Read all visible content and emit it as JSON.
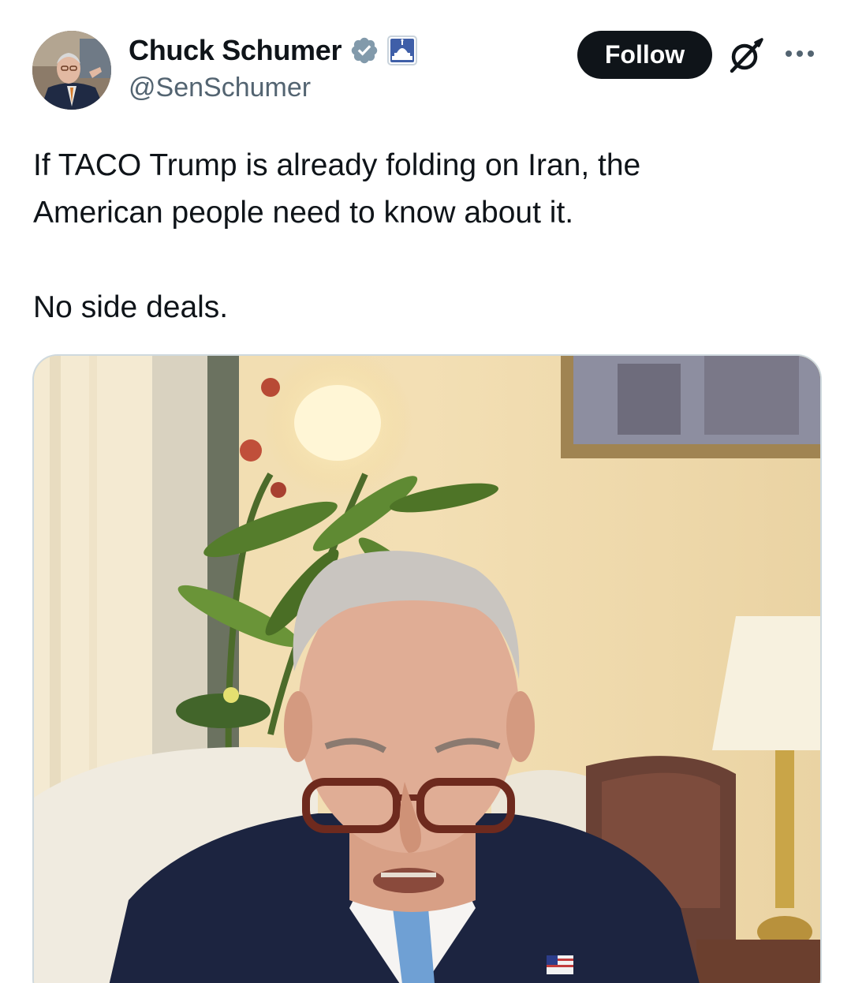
{
  "author": {
    "display_name": "Chuck Schumer",
    "handle": "@SenSchumer",
    "verified_icon": "verified-badge-icon",
    "affiliation_icon": "capitol-building-icon",
    "avatar": "profile-photo"
  },
  "actions": {
    "follow_label": "Follow",
    "grok_icon": "grok-icon",
    "more_icon": "more-options-icon"
  },
  "tweet": {
    "line1": "If TACO Trump is already folding on Iran, the",
    "line2": "American people need to know about it.",
    "line3": "No side deals."
  },
  "media": {
    "type": "video-thumbnail"
  },
  "colors": {
    "text_primary": "#0f1419",
    "text_secondary": "#536471",
    "verified_blue": "#1d9bf0",
    "follow_bg": "#0f1419",
    "border": "#cfd9de"
  }
}
